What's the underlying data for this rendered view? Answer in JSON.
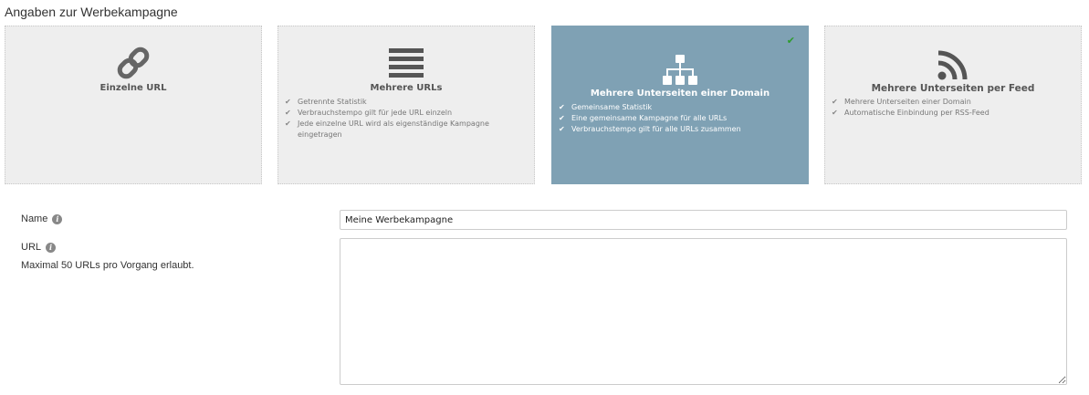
{
  "section_title": "Angaben zur Werbekampagne",
  "campaign_types": [
    {
      "title": "Einzelne URL",
      "icon": "chain-link-icon",
      "selected": false,
      "features": []
    },
    {
      "title": "Mehrere URLs",
      "icon": "list-lines-icon",
      "selected": false,
      "features": [
        "Getrennte Statistik",
        "Verbrauchstempo gilt für jede URL einzeln",
        "Jede einzelne URL wird als eigenständige Kampagne eingetragen"
      ]
    },
    {
      "title": "Mehrere Unterseiten einer Domain",
      "icon": "sitemap-icon",
      "selected": true,
      "features": [
        "Gemeinsame Statistik",
        "Eine gemeinsame Kampagne für alle URLs",
        "Verbrauchstempo gilt für alle URLs zusammen"
      ]
    },
    {
      "title": "Mehrere Unterseiten per Feed",
      "icon": "rss-feed-icon",
      "selected": false,
      "features": [
        "Mehrere Unterseiten einer Domain",
        "Automatische Einbindung per RSS-Feed"
      ]
    }
  ],
  "colors": {
    "card_background": "#eeeeee",
    "card_selected_background": "#7fa1b4",
    "selected_check": "#2e9c2e"
  },
  "form": {
    "name_label": "Name",
    "name_value": "Meine Werbekampagne",
    "url_label": "URL",
    "url_hint": "Maximal 50 URLs pro Vorgang erlaubt.",
    "url_value": ""
  }
}
